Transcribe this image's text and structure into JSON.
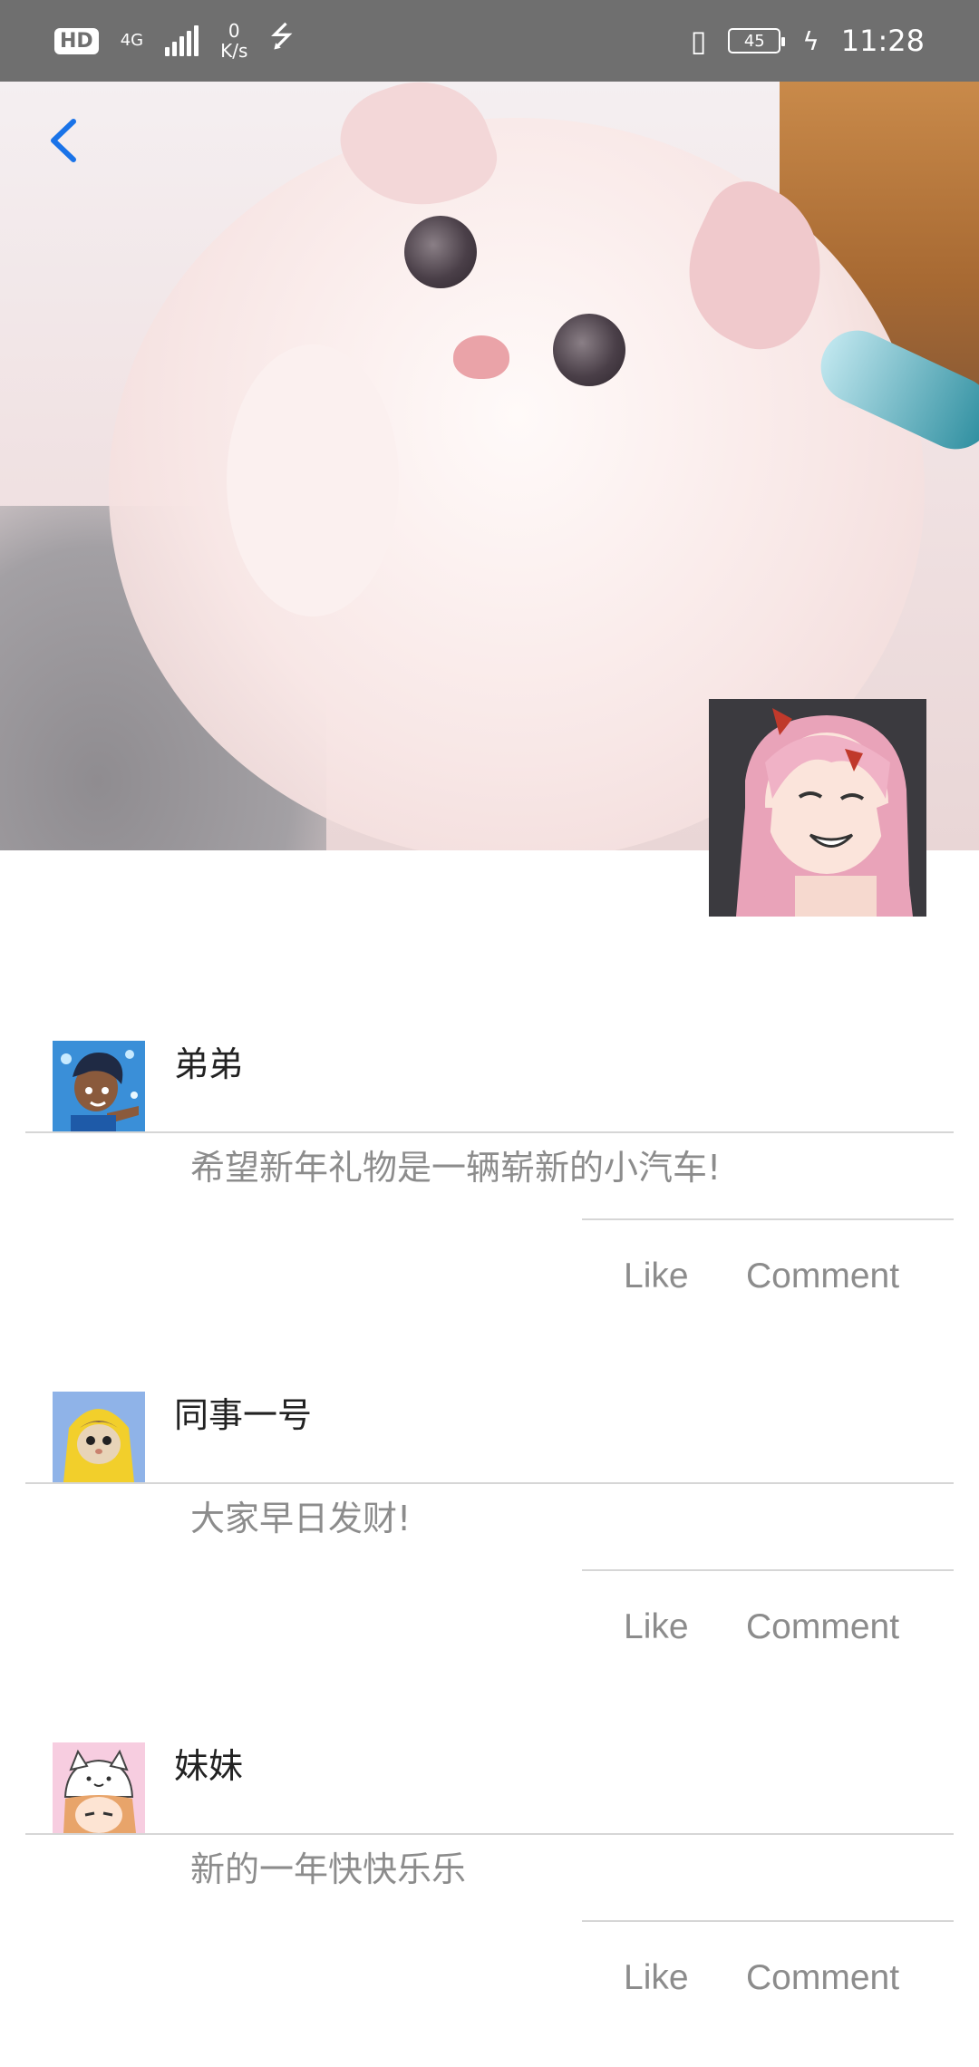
{
  "status_bar": {
    "hd": "HD",
    "network": "4G",
    "speed_value": "0",
    "speed_unit": "K/s",
    "battery": "45",
    "time": "11:28",
    "icons": [
      "signal-icon",
      "usb-icon",
      "vibrate-icon",
      "battery-icon",
      "charging-icon"
    ]
  },
  "header": {
    "back_icon": "chevron-left-icon",
    "accent_color": "#1a73e8"
  },
  "posts": [
    {
      "name": "弟弟",
      "content": "希望新年礼物是一辆崭新的小汽车!",
      "like": "Like",
      "comment": "Comment"
    },
    {
      "name": "同事一号",
      "content": "大家早日发财!",
      "like": "Like",
      "comment": "Comment"
    },
    {
      "name": "妹妹",
      "content": "新的一年快快乐乐",
      "like": "Like",
      "comment": "Comment"
    }
  ]
}
